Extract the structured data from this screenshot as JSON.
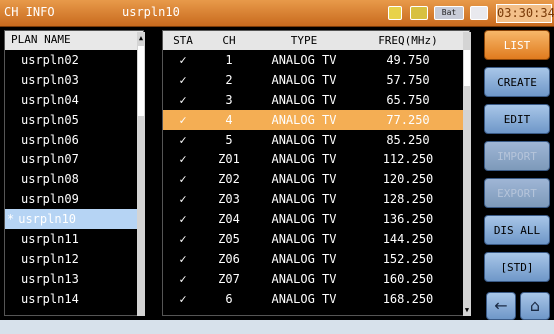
{
  "header": {
    "title": "CH INFO",
    "plan": "usrpln10",
    "battery_label": "Bat",
    "clock": "03:30:34"
  },
  "plan_list": {
    "header": "PLAN NAME",
    "selected_marker": "*",
    "items": [
      "usrpln02",
      "usrpln03",
      "usrpln04",
      "usrpln05",
      "usrpln06",
      "usrpln07",
      "usrpln08",
      "usrpln09",
      "usrpln10",
      "usrpln11",
      "usrpln12",
      "usrpln13",
      "usrpln14"
    ],
    "selected_index": 8
  },
  "channel_table": {
    "columns": [
      "STA",
      "CH",
      "TYPE",
      "FREQ(MHz)"
    ],
    "rows": [
      {
        "sta": "✓",
        "ch": "1",
        "type": "ANALOG TV",
        "freq": "49.750"
      },
      {
        "sta": "✓",
        "ch": "2",
        "type": "ANALOG TV",
        "freq": "57.750"
      },
      {
        "sta": "✓",
        "ch": "3",
        "type": "ANALOG TV",
        "freq": "65.750"
      },
      {
        "sta": "✓",
        "ch": "4",
        "type": "ANALOG TV",
        "freq": "77.250"
      },
      {
        "sta": "✓",
        "ch": "5",
        "type": "ANALOG TV",
        "freq": "85.250"
      },
      {
        "sta": "✓",
        "ch": "Z01",
        "type": "ANALOG TV",
        "freq": "112.250"
      },
      {
        "sta": "✓",
        "ch": "Z02",
        "type": "ANALOG TV",
        "freq": "120.250"
      },
      {
        "sta": "✓",
        "ch": "Z03",
        "type": "ANALOG TV",
        "freq": "128.250"
      },
      {
        "sta": "✓",
        "ch": "Z04",
        "type": "ANALOG TV",
        "freq": "136.250"
      },
      {
        "sta": "✓",
        "ch": "Z05",
        "type": "ANALOG TV",
        "freq": "144.250"
      },
      {
        "sta": "✓",
        "ch": "Z06",
        "type": "ANALOG TV",
        "freq": "152.250"
      },
      {
        "sta": "✓",
        "ch": "Z07",
        "type": "ANALOG TV",
        "freq": "160.250"
      },
      {
        "sta": "✓",
        "ch": "6",
        "type": "ANALOG TV",
        "freq": "168.250"
      }
    ],
    "selected_index": 3
  },
  "buttons": {
    "list": "LIST",
    "create": "CREATE",
    "edit": "EDIT",
    "import": "IMPORT",
    "export": "EXPORT",
    "dis_all": "DIS ALL",
    "std": "[STD]"
  },
  "nav": {
    "back_icon": "back-arrow-icon",
    "home_icon": "home-icon"
  },
  "colors": {
    "accent_orange": "#e07b1e",
    "selected_row": "#f4ae54",
    "selected_plan": "#b6d4f4",
    "button_blue": "#6f97c8"
  }
}
